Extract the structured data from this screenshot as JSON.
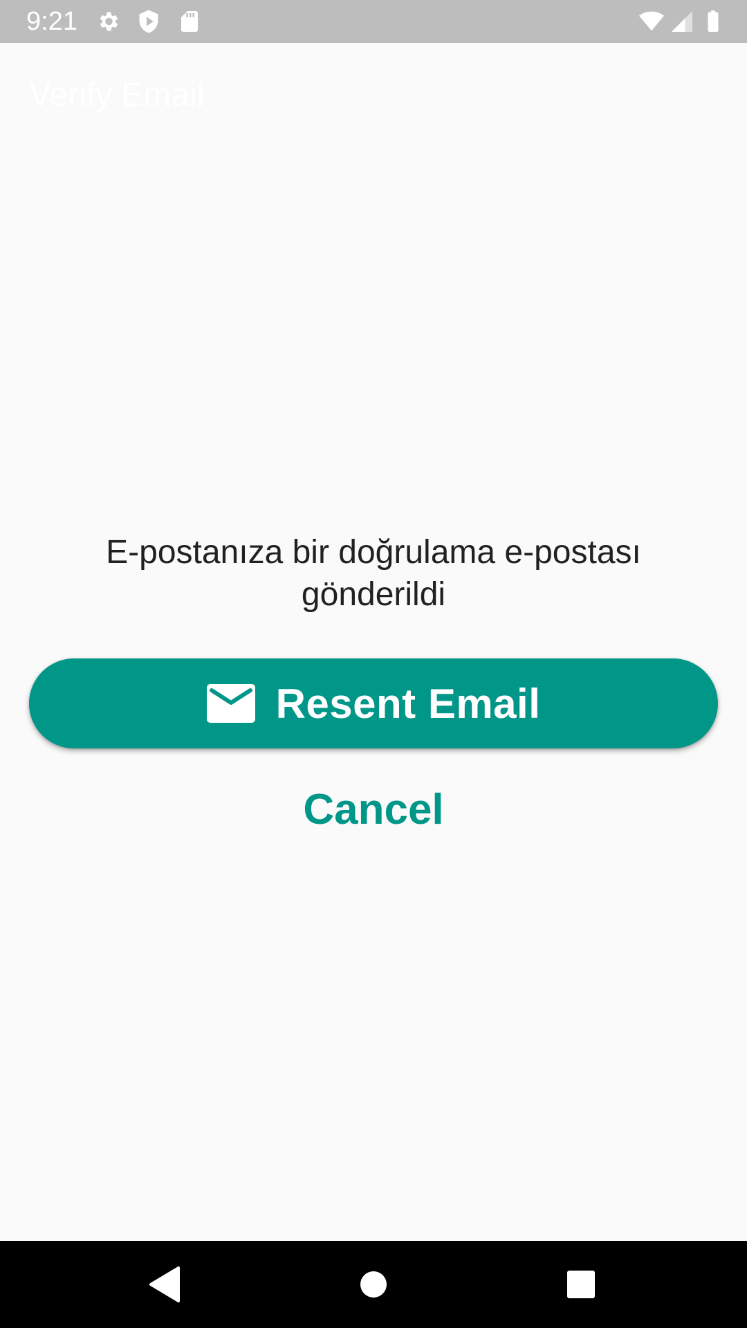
{
  "status_bar": {
    "time": "9:21",
    "icons": [
      "gear-icon",
      "shield-icon",
      "sd-card-icon",
      "wifi-icon",
      "signal-icon",
      "battery-icon"
    ]
  },
  "app_bar": {
    "title": "Verify Email"
  },
  "main": {
    "message": "E-postanıza bir doğrulama e-postası gönderildi",
    "resend_button": {
      "icon": "mail-icon",
      "label": "Resent Email"
    },
    "cancel_label": "Cancel"
  },
  "nav_bar": {
    "buttons": [
      "back-icon",
      "home-icon",
      "recents-icon"
    ]
  },
  "colors": {
    "accent": "#009688",
    "status_bar": "#bdbdbd",
    "background": "#fafafa",
    "text": "#212121",
    "nav_bar": "#000000"
  }
}
